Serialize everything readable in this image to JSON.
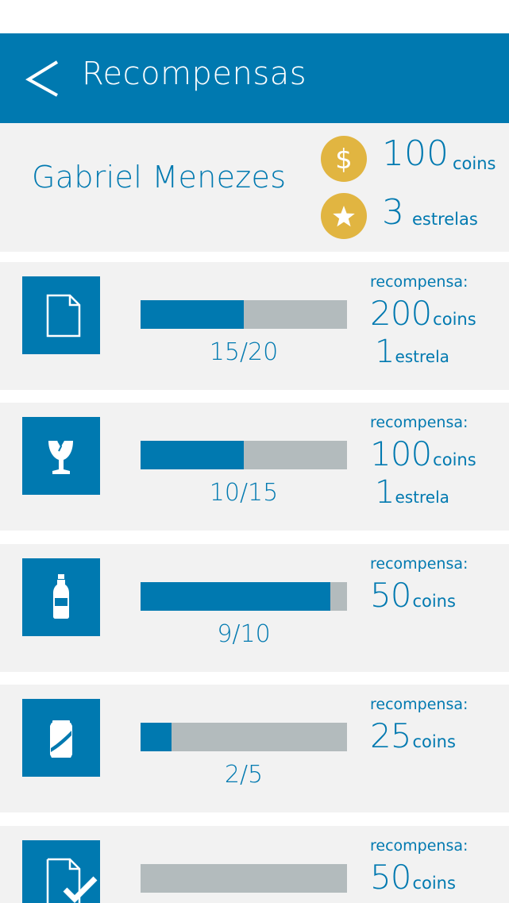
{
  "header": {
    "title": "Recompensas"
  },
  "profile": {
    "name": "Gabriel Menezes",
    "coins": "100",
    "coins_unit": "coins",
    "stars": "3",
    "stars_unit": "estrelas"
  },
  "colors": {
    "primary": "#0079b0",
    "gold": "#e1b541",
    "track": "#b3bbbd",
    "panel": "#f2f2f2"
  },
  "challenges": [
    {
      "icon": "document-icon",
      "progress": "15/20",
      "fraction": 0.5,
      "reward_label": "recompensa:",
      "reward_coins": "200",
      "reward_coins_unit": "coins",
      "reward_stars": "1",
      "reward_stars_unit": "estrela"
    },
    {
      "icon": "broken-glass-icon",
      "progress": "10/15",
      "fraction": 0.5,
      "reward_label": "recompensa:",
      "reward_coins": "100",
      "reward_coins_unit": "coins",
      "reward_stars": "1",
      "reward_stars_unit": "estrela"
    },
    {
      "icon": "plastic-bottle-icon",
      "progress": "9/10",
      "fraction": 0.92,
      "reward_label": "recompensa:",
      "reward_coins": "50",
      "reward_coins_unit": "coins"
    },
    {
      "icon": "can-icon",
      "progress": "2/5",
      "fraction": 0.15,
      "reward_label": "recompensa:",
      "reward_coins": "25",
      "reward_coins_unit": "coins"
    },
    {
      "icon": "document-check-icon",
      "progress": "",
      "fraction": 0.0,
      "reward_label": "recompensa:",
      "reward_coins": "50",
      "reward_coins_unit": "coins"
    }
  ]
}
